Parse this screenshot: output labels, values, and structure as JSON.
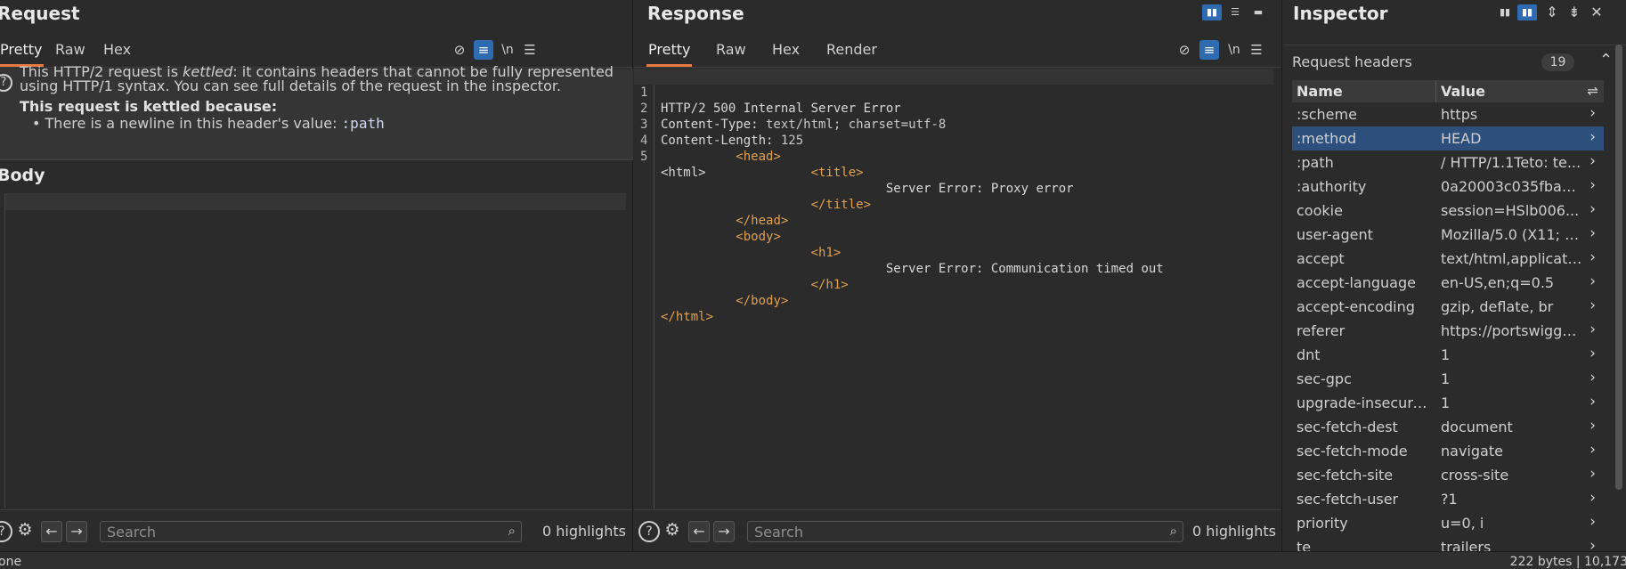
{
  "request": {
    "title": "Request",
    "tabs": [
      "Pretty",
      "Raw",
      "Hex"
    ],
    "newline_label": "\\n",
    "notice": {
      "line1_a": "This HTTP/2 request is ",
      "line1_em": "kettled",
      "line1_b": ": it contains headers that cannot be fully represented",
      "line2": "using HTTP/1 syntax. You can see full details of the request in the inspector.",
      "heading": "This request is kettled because:",
      "bullet": "• There is a newline in this header's value: ",
      "bullet_code": ":path"
    },
    "body_title": "Body",
    "search_placeholder": "Search",
    "highlights": "0 highlights"
  },
  "response": {
    "title": "Response",
    "tabs": [
      "Pretty",
      "Raw",
      "Hex",
      "Render"
    ],
    "newline_label": "\\n",
    "line_numbers": [
      "1",
      "2",
      "3",
      "4",
      "5"
    ],
    "status_line": "HTTP/2 500 Internal Server Error",
    "headers": [
      {
        "name": "Content-Type:",
        "value": " text/html; charset=utf-8"
      },
      {
        "name": "Content-Length:",
        "value": " 125"
      }
    ],
    "html_lines": [
      {
        "indent": "",
        "text": "<html>"
      },
      {
        "indent": "     ",
        "text": "<head>"
      },
      {
        "indent": "          ",
        "text": "<title>"
      },
      {
        "indent": "               ",
        "text": "Server Error: Proxy error"
      },
      {
        "indent": "          ",
        "text": "</title>"
      },
      {
        "indent": "     ",
        "text": "</head>"
      },
      {
        "indent": "     ",
        "text": "<body>"
      },
      {
        "indent": "          ",
        "text": "<h1>"
      },
      {
        "indent": "               ",
        "text": "Server Error: Communication timed out"
      },
      {
        "indent": "          ",
        "text": "</h1>"
      },
      {
        "indent": "     ",
        "text": "</body>"
      },
      {
        "indent": "",
        "text": "</html>"
      }
    ],
    "search_placeholder": "Search",
    "highlights": "0 highlights"
  },
  "inspector": {
    "title": "Inspector",
    "section": "Request headers",
    "count": "19",
    "col_name": "Name",
    "col_value": "Value",
    "rows": [
      {
        "name": ":scheme",
        "value": "https",
        "selected": false
      },
      {
        "name": ":method",
        "value": "HEAD",
        "selected": true
      },
      {
        "name": ":path",
        "value": "/ HTTP/1.1Teto: te...",
        "selected": false
      },
      {
        "name": ":authority",
        "value": "0a20003c035fba9...",
        "selected": false
      },
      {
        "name": "cookie",
        "value": "session=HSlb006...",
        "selected": false
      },
      {
        "name": "user-agent",
        "value": "Mozilla/5.0 (X11; L...",
        "selected": false
      },
      {
        "name": "accept",
        "value": "text/html,applicati...",
        "selected": false
      },
      {
        "name": "accept-language",
        "value": "en-US,en;q=0.5",
        "selected": false
      },
      {
        "name": "accept-encoding",
        "value": "gzip, deflate, br",
        "selected": false
      },
      {
        "name": "referer",
        "value": "https://portswigge...",
        "selected": false
      },
      {
        "name": "dnt",
        "value": "1",
        "selected": false
      },
      {
        "name": "sec-gpc",
        "value": "1",
        "selected": false
      },
      {
        "name": "upgrade-insecure-...",
        "value": "1",
        "selected": false
      },
      {
        "name": "sec-fetch-dest",
        "value": "document",
        "selected": false
      },
      {
        "name": "sec-fetch-mode",
        "value": "navigate",
        "selected": false
      },
      {
        "name": "sec-fetch-site",
        "value": "cross-site",
        "selected": false
      },
      {
        "name": "sec-fetch-user",
        "value": "?1",
        "selected": false
      },
      {
        "name": "priority",
        "value": "u=0, i",
        "selected": false
      },
      {
        "name": "te",
        "value": "trailers",
        "selected": false
      }
    ]
  },
  "status": {
    "left": "one",
    "right": "222 bytes | 10,173"
  },
  "colors": {
    "accent_tab": "#e8793f",
    "toggle_on": "#2f6bb0",
    "selected_row": "#2c4f7c",
    "tag": "#e0a050"
  }
}
